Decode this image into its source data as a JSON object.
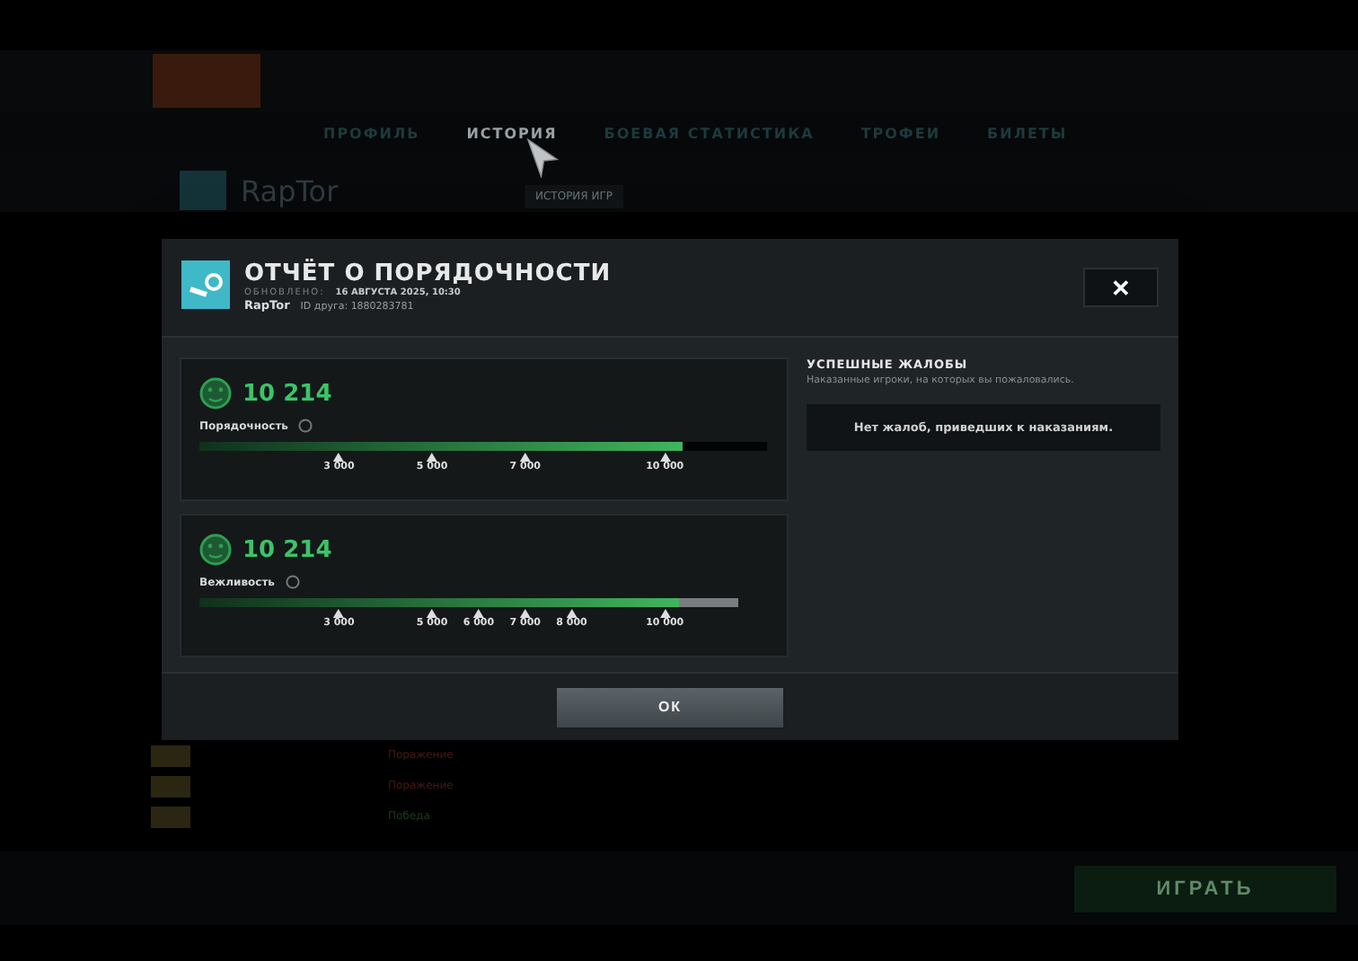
{
  "background": {
    "subnav": [
      {
        "label": "ПРОФИЛЬ",
        "selected": false
      },
      {
        "label": "ИСТОРИЯ",
        "selected": true
      },
      {
        "label": "БОЕВАЯ СТАТИСТИКА",
        "selected": false
      },
      {
        "label": "ТРОФЕИ",
        "selected": false
      },
      {
        "label": "БИЛЕТЫ",
        "selected": false
      }
    ],
    "player": "RapTor",
    "history_tab": "ИСТОРИЯ ИГР",
    "play_button": "ИГРАТЬ",
    "matches": [
      {
        "result": "Поражение",
        "win": false
      },
      {
        "result": "Поражение",
        "win": false
      },
      {
        "result": "Победа",
        "win": true
      }
    ]
  },
  "dialog": {
    "title": "ОТЧЁТ О ПОРЯДОЧНОСТИ",
    "updated_label": "ОБНОВЛЕНО:",
    "updated": "16 АВГУСТА 2025, 10:30",
    "player": "RapTor",
    "friend_id": "ID друга: 1880283781",
    "close": "✕",
    "meters": [
      {
        "score": "10 214",
        "label": "Порядочность",
        "kind": "dark",
        "level": 0.85,
        "ticks": [
          "3 000",
          "5 000",
          "7 000",
          "10 000"
        ]
      },
      {
        "score": "10 214",
        "label": "Вежливость",
        "kind": "grey",
        "level": 0.89,
        "ticks": [
          "3 000",
          "5 000",
          "6 000",
          "7 000",
          "8 000",
          "10 000"
        ]
      }
    ],
    "reports": {
      "title": "УСПЕШНЫЕ ЖАЛОБЫ",
      "subtitle": "Наказанные игроки, на которых вы пожаловались.",
      "empty": "Нет жалоб, приведших к наказаниям."
    },
    "ok": "ОК"
  }
}
